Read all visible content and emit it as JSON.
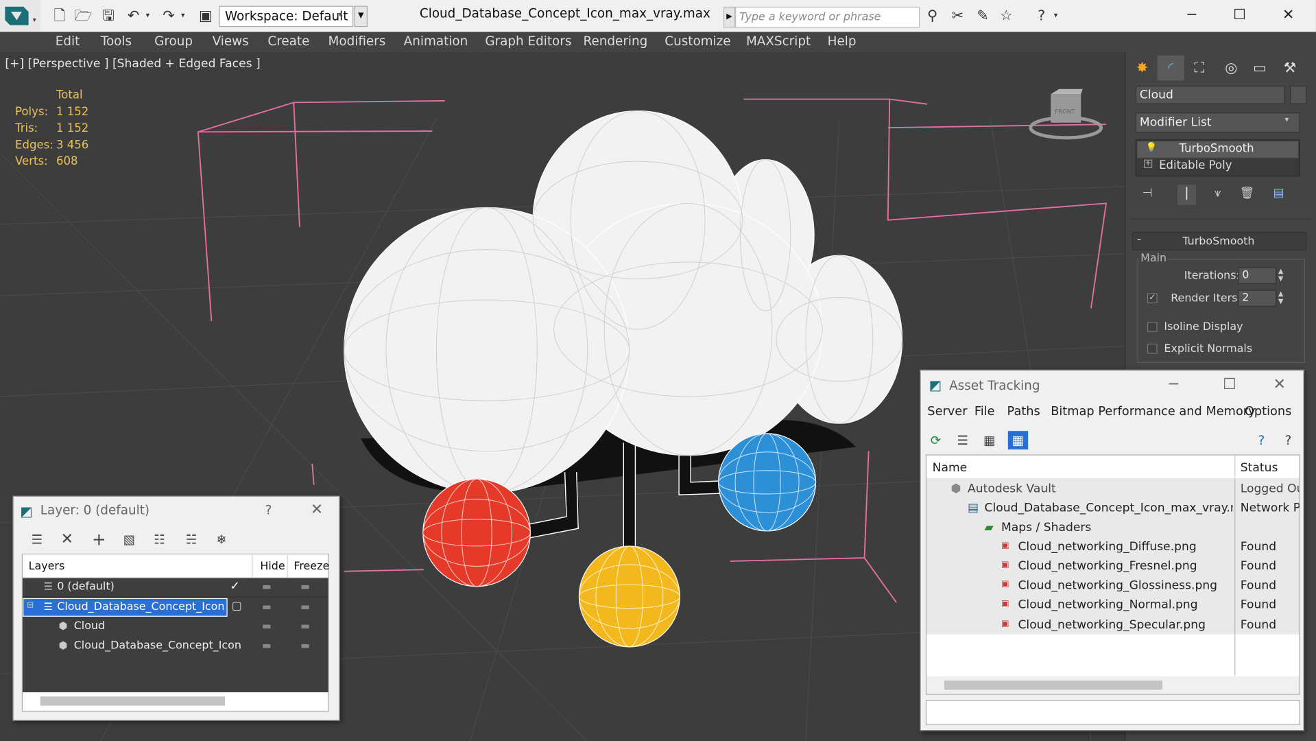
{
  "app": {
    "workspace_label": "Workspace: Default",
    "window_title": "Cloud_Database_Concept_Icon_max_vray.max",
    "search_placeholder": "Type a keyword or phrase"
  },
  "menu": [
    "Edit",
    "Tools",
    "Group",
    "Views",
    "Create",
    "Modifiers",
    "Animation",
    "Graph Editors",
    "Rendering",
    "Customize",
    "MAXScript",
    "Help"
  ],
  "viewport": {
    "label": "[+] [Perspective ] [Shaded + Edged Faces ]",
    "stats_header": "Total",
    "stats": [
      {
        "label": "Polys:",
        "value": "1 152"
      },
      {
        "label": "Tris:",
        "value": "1 152"
      },
      {
        "label": "Edges:",
        "value": "3 456"
      },
      {
        "label": "Verts:",
        "value": "608"
      }
    ],
    "viewcube_label": "FRONT"
  },
  "command_panel": {
    "object_name": "Cloud",
    "modifier_list": "Modifier List",
    "stack": [
      "TurboSmooth",
      "Editable Poly"
    ],
    "rollout_title": "TurboSmooth",
    "group_main": "Main",
    "iterations_label": "Iterations:",
    "iterations_value": "0",
    "render_iters_label": "Render Iters:",
    "render_iters_value": "2",
    "isoline_label": "Isoline Display",
    "explicit_normals_label": "Explicit Normals"
  },
  "layer_dialog": {
    "title": "Layer: 0 (default)",
    "help": "?",
    "columns": [
      "Layers",
      "Hide",
      "Freeze"
    ],
    "rows": [
      {
        "name": "0 (default)",
        "selected": false,
        "indent": 1
      },
      {
        "name": "Cloud_Database_Concept_Icon",
        "selected": true,
        "indent": 1
      },
      {
        "name": "Cloud",
        "selected": false,
        "indent": 2
      },
      {
        "name": "Cloud_Database_Concept_Icon",
        "selected": false,
        "indent": 2
      }
    ]
  },
  "asset_dialog": {
    "title": "Asset Tracking",
    "menu": [
      "Server",
      "File",
      "Paths",
      "Bitmap Performance and Memory",
      "Options"
    ],
    "columns": [
      "Name",
      "Status"
    ],
    "rows": [
      {
        "name": "Autodesk Vault",
        "status": "Logged Ou",
        "level": 1
      },
      {
        "name": "Cloud_Database_Concept_Icon_max_vray.max",
        "status": "Network Pa",
        "level": 2
      },
      {
        "name": "Maps / Shaders",
        "status": "",
        "level": 3
      },
      {
        "name": "Cloud_networking_Diffuse.png",
        "status": "Found",
        "level": 4
      },
      {
        "name": "Cloud_networking_Fresnel.png",
        "status": "Found",
        "level": 4
      },
      {
        "name": "Cloud_networking_Glossiness.png",
        "status": "Found",
        "level": 4
      },
      {
        "name": "Cloud_networking_Normal.png",
        "status": "Found",
        "level": 4
      },
      {
        "name": "Cloud_networking_Specular.png",
        "status": "Found",
        "level": 4
      }
    ]
  },
  "colors": {
    "red_sphere": "#e53a2a",
    "blue_sphere": "#2d8fd6",
    "yellow_sphere": "#f2b81e",
    "cloud": "#f2f2f2",
    "selection": "#2a6fd6",
    "stats": "#e8c25a"
  }
}
